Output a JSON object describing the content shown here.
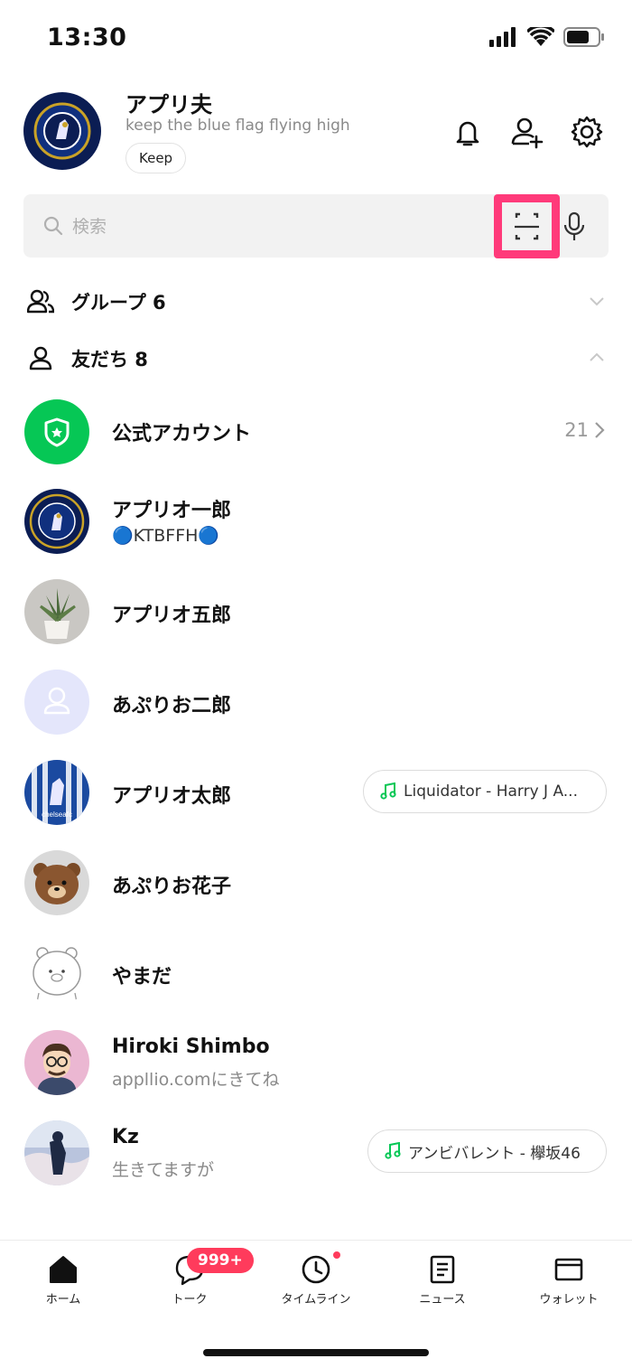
{
  "status_bar": {
    "time": "13:30"
  },
  "profile": {
    "name": "アプリ夫",
    "status_message": "keep the blue flag flying high",
    "keep_label": "Keep"
  },
  "search": {
    "placeholder": "検索"
  },
  "sections": {
    "groups_label": "グループ 6",
    "friends_label": "友だち 8"
  },
  "official_account": {
    "label": "公式アカウント",
    "count": "21"
  },
  "friends": [
    {
      "name": "アプリオ一郎",
      "status": "🔵KTBFFH🔵"
    },
    {
      "name": "アプリオ五郎"
    },
    {
      "name": "あぷりお二郎"
    },
    {
      "name": "アプリオ太郎",
      "music": "Liquidator - Harry J A..."
    },
    {
      "name": "あぷりお花子"
    },
    {
      "name": "やまだ"
    },
    {
      "name": "Hiroki Shimbo",
      "status": "appllio.comにきてね"
    },
    {
      "name": "Kz",
      "status": "生きてますが",
      "music": "アンビバレント - 欅坂46"
    }
  ],
  "tabs": [
    {
      "label": "ホーム",
      "icon": "home-icon"
    },
    {
      "label": "トーク",
      "icon": "chat-icon",
      "badge": "999+"
    },
    {
      "label": "タイムライン",
      "icon": "clock-icon"
    },
    {
      "label": "ニュース",
      "icon": "news-icon"
    },
    {
      "label": "ウォレット",
      "icon": "wallet-icon"
    }
  ],
  "colors": {
    "accent_pink": "#ff3a7a",
    "official_green": "#06c755",
    "badge_red": "#ff3b5c",
    "music_green": "#06c755"
  }
}
